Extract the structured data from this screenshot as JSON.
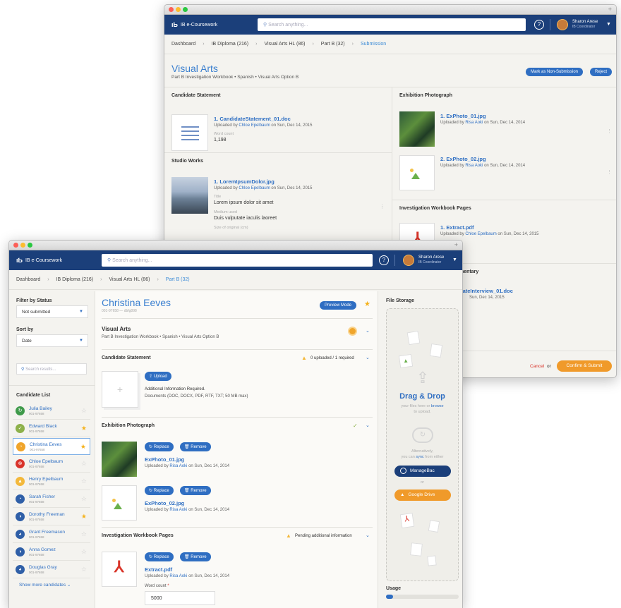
{
  "back_window": {
    "app_name": "IB e-Coursework",
    "search_placeholder": "Search anything...",
    "help": "?",
    "user": {
      "name": "Sharon Arese",
      "role": "IB Coordinator"
    },
    "breadcrumbs": [
      "Dashboard",
      "IB Diploma (216)",
      "Visual Arts HL (86)",
      "Part B (32)",
      "Submission"
    ],
    "title": "Visual Arts",
    "subtitle": "Part B Investigation Workbook  •  Spanish  •  Visual Arts Option B",
    "mark_button": "Mark as Non-Submission",
    "reject_button": "Reject",
    "candidate_statement": {
      "heading": "Candidate Statement",
      "file": "1.  CandidateStatement_01.doc",
      "uploaded_prefix": "Uploaded by",
      "uploader": "Chloe Epelbaum",
      "uploaded_suffix": "on Sun, Dec 14, 2015",
      "count_label": "Word count",
      "count": "1,198"
    },
    "studio_works": {
      "heading": "Studio Works",
      "file": "1.  LoremIpsumDolor.jpg",
      "uploaded_prefix": "Uploaded by",
      "uploader": "Chloe Epelbaum",
      "uploaded_suffix": "on Sun, Dec 14, 2015",
      "title_label": "Title",
      "title_value": "Lorem ipsum dolor sit amet",
      "medium_label": "Medium used",
      "medium_value": "Duis vulputate iaculis laoreet",
      "size_label": "Size of original (cm)"
    },
    "exhibition_photo": {
      "heading": "Exhibition Photograph",
      "files": [
        {
          "name": "1.  ExPhoto_01.jpg",
          "uploader": "Risa Aoki",
          "suffix": "on Sun, Dec 14, 2014"
        },
        {
          "name": "2.  ExPhoto_02.jpg",
          "uploader": "Risa Aoki",
          "suffix": "on Sun, Dec 14, 2014"
        }
      ],
      "uploaded_prefix": "Uploaded by"
    },
    "workbook_pages": {
      "heading": "Investigation Workbook Pages",
      "file": "1.  Extract.pdf",
      "uploaded_prefix": "Uploaded by",
      "uploader": "Chloe Epelbaum",
      "suffix": "on Sun, Dec 14, 2015"
    },
    "commentary": {
      "heading": "mentary",
      "file": "dateInterview_01.doc",
      "suffix": "Sun, Dec 14, 2015"
    },
    "cancel": "Cancel",
    "or": "or",
    "confirm": "Confirm & Submit"
  },
  "front_window": {
    "app_name": "IB e-Coursework",
    "search_placeholder": "Search anything...",
    "help": "?",
    "user": {
      "name": "Sharon Arese",
      "role": "IB Coordinator"
    },
    "breadcrumbs": [
      "Dashboard",
      "IB Diploma (216)",
      "Visual Arts HL (86)",
      "Part B (32)"
    ],
    "sidebar": {
      "filter_label": "Filter by Status",
      "filter_value": "Not submitted",
      "sort_label": "Sort by",
      "sort_value": "Date",
      "search_placeholder": "Search results...",
      "list_heading": "Candidate List",
      "show_more": "Show more candidates",
      "candidates": [
        {
          "name": "Julia Bailey",
          "id": "001-97658",
          "color": "#3f9a4a",
          "icon": "↻",
          "starred": false
        },
        {
          "name": "Edward Black",
          "id": "001-97658",
          "color": "#8db14a",
          "icon": "✓",
          "starred": true
        },
        {
          "name": "Christina Eeves",
          "id": "001-97658",
          "color": "#f0a52b",
          "icon": "◔",
          "starred": true,
          "selected": true
        },
        {
          "name": "Chloe Epelbaum",
          "id": "001-97658",
          "color": "#d9342b",
          "icon": "⊗",
          "starred": false
        },
        {
          "name": "Henry Epelbaum",
          "id": "001-97658",
          "color": "#f3b83a",
          "icon": "▲",
          "starred": false
        },
        {
          "name": "Sarah Fisher",
          "id": "001-97658",
          "color": "#2f5fa7",
          "icon": "◔",
          "starred": false
        },
        {
          "name": "Dorothy Freeman",
          "id": "001-97658",
          "color": "#2f5fa7",
          "icon": "◑",
          "starred": true
        },
        {
          "name": "Grant Freemason",
          "id": "001-97658",
          "color": "#2f5fa7",
          "icon": "◕",
          "starred": false
        },
        {
          "name": "Anna Gomez",
          "id": "001-97658",
          "color": "#2f5fa7",
          "icon": "◑",
          "starred": false
        },
        {
          "name": "Douglas Gray",
          "id": "001-97658",
          "color": "#2f5fa7",
          "icon": "◕",
          "starred": false
        }
      ]
    },
    "main": {
      "candidate_name": "Christina Eeves",
      "candidate_meta": "001-97658  —  dbfg898",
      "preview_button": "Preview Mode",
      "subject": "Visual Arts",
      "subject_detail": "Part B Investigation Workbook  •  Spanish  •  Visual Arts Option B",
      "statement": {
        "heading": "Candidate Statement",
        "status": "0 uploaded / 1 required",
        "upload_button": "Upload",
        "info1": "Additional Information Required.",
        "info2": "Documents (DOC, DOCX, PDF, RTF, TXT; 50 MB max)"
      },
      "exhibition": {
        "heading": "Exhibition Photograph",
        "replace": "Replace",
        "remove": "Remove",
        "files": [
          {
            "name": "ExPhoto_01.jpg",
            "uploaded": "Uploaded by",
            "uploader": "Risa Aoki",
            "suffix": "on Sun, Dec 14, 2014"
          },
          {
            "name": "ExPhoto_02.jpg",
            "uploaded": "Uploaded by",
            "uploader": "Risa Aoki",
            "suffix": "on Sun, Dec 14, 2014"
          }
        ]
      },
      "workbook": {
        "heading": "Investigation Workbook Pages",
        "status": "Pending additional information",
        "replace": "Replace",
        "remove": "Remove",
        "file": "Extract.pdf",
        "uploaded": "Uploaded by",
        "uploader": "Risa Aoki",
        "suffix": "on Sun, Dec 14, 2014",
        "count_label": "Word count",
        "count_value": "5000"
      }
    },
    "storage": {
      "heading": "File Storage",
      "drag_title": "Drag & Drop",
      "drag_sub1": "your files here or",
      "drag_browse": "browse",
      "drag_sub2": "to upload.",
      "alt1": "Alternatively,",
      "alt2": "you can",
      "alt_sync": "sync",
      "alt3": "from either",
      "managebac": "ManageBac",
      "or": "or",
      "gdrive": "Google Drive",
      "usage_label": "Usage",
      "usage_fraction": 0.1
    }
  }
}
